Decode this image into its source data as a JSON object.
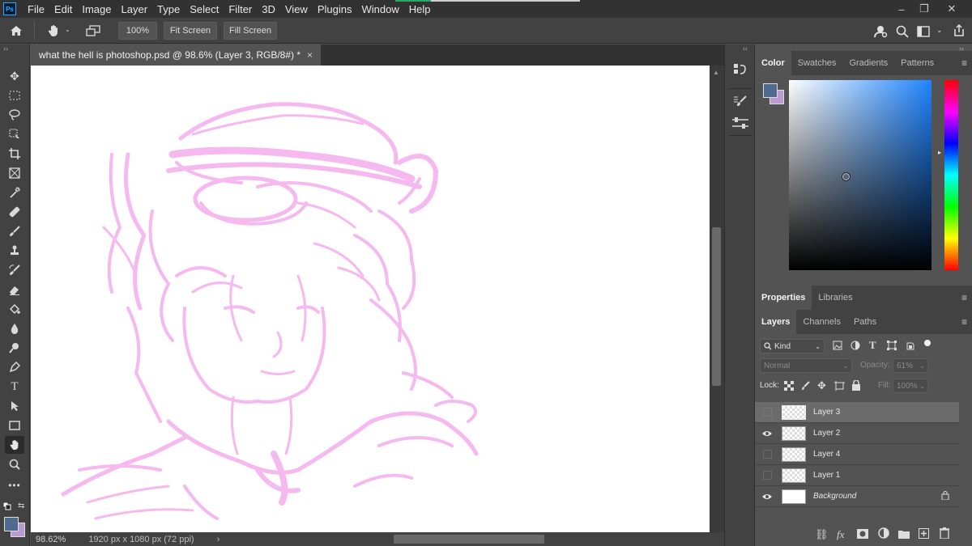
{
  "app": {
    "logo_text": "Ps"
  },
  "menu": [
    "File",
    "Edit",
    "Image",
    "Layer",
    "Type",
    "Select",
    "Filter",
    "3D",
    "View",
    "Plugins",
    "Window",
    "Help"
  ],
  "window_controls": {
    "minimize": "–",
    "restore": "❐",
    "close": "✕"
  },
  "options_bar": {
    "zoom_100_label": "100%",
    "fit_screen_label": "Fit Screen",
    "fill_screen_label": "Fill Screen"
  },
  "document": {
    "tab_title": "what the hell is photoshop.psd @ 98.6% (Layer 3, RGB/8#) *",
    "close_glyph": "×",
    "stroke_color": "#f5b8ef"
  },
  "status": {
    "zoom": "98.62%",
    "doc_info": "1920 px x 1080 px (72 ppi)",
    "arrow": "›"
  },
  "color_panel": {
    "tabs": [
      "Color",
      "Swatches",
      "Gradients",
      "Patterns"
    ],
    "foreground": "#4e6b8e",
    "background": "#b99ad1",
    "hue_color": "#1f84ff"
  },
  "properties_panel": {
    "tabs": [
      "Properties",
      "Libraries"
    ]
  },
  "layers_panel": {
    "tabs": [
      "Layers",
      "Channels",
      "Paths"
    ],
    "filter_kind": "Kind",
    "blend_mode": "Normal",
    "opacity_label": "Opacity:",
    "opacity_value": "61%",
    "lock_label": "Lock:",
    "fill_label": "Fill:",
    "fill_value": "100%",
    "layers": [
      {
        "name": "Layer 3",
        "visible": false,
        "selected": true,
        "italic": false
      },
      {
        "name": "Layer 2",
        "visible": true,
        "selected": false,
        "italic": false
      },
      {
        "name": "Layer 4",
        "visible": false,
        "selected": false,
        "italic": false
      },
      {
        "name": "Layer 1",
        "visible": false,
        "selected": false,
        "italic": false
      },
      {
        "name": "Background",
        "visible": true,
        "selected": false,
        "italic": true
      }
    ]
  }
}
